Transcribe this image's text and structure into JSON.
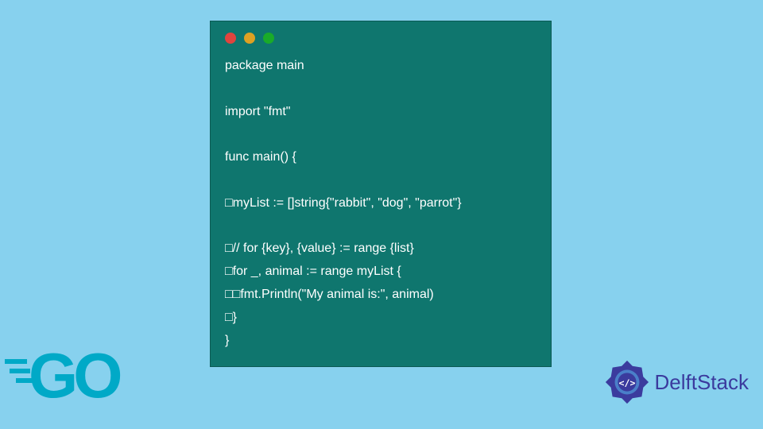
{
  "code": {
    "line1": "package main",
    "line2": "",
    "line3": "import \"fmt\"",
    "line4": "",
    "line5": "func main() {",
    "line6": "",
    "line7": "□myList := []string{\"rabbit\", \"dog\", \"parrot\"}",
    "line8": "",
    "line9": "□// for {key}, {value} := range {list}",
    "line10": "□for _, animal := range myList {",
    "line11": "□□fmt.Println(\"My animal is:\", animal)",
    "line12": "□}",
    "line13": "}"
  },
  "logos": {
    "go": "GO",
    "delftstack": "DelftStack",
    "delftstack_icon": "</>"
  }
}
